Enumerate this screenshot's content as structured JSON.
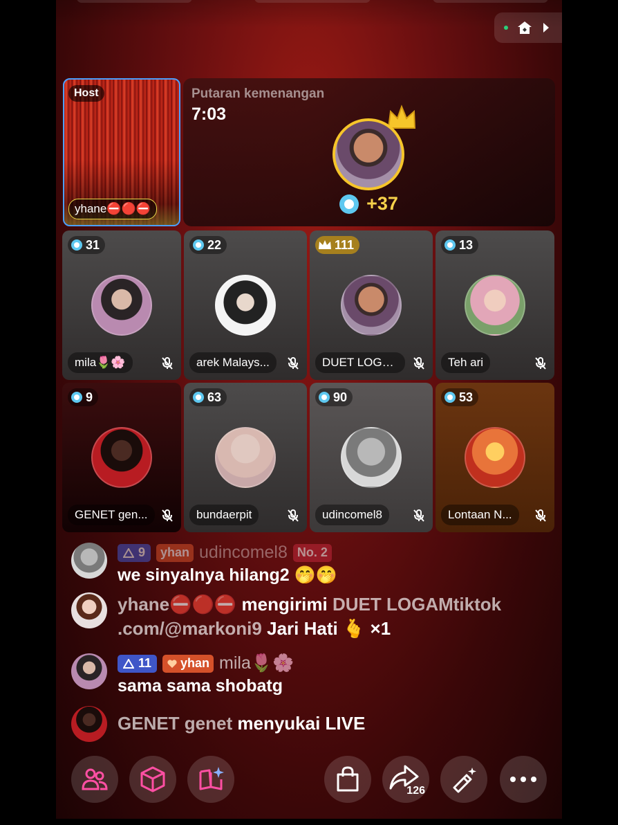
{
  "topbar": {
    "status_color": "#2bd07a"
  },
  "host_tile": {
    "badge": "Host",
    "name": "yhane⛔🔴⛔"
  },
  "round": {
    "label": "Putaran kemenangan",
    "timer": "7:03",
    "score": "+37"
  },
  "participants": [
    {
      "name": "mila🌷🌸",
      "points": "31",
      "badge": "diamond"
    },
    {
      "name": "arek Malays...",
      "points": "22",
      "badge": "diamond"
    },
    {
      "name": "DUET LOGA...",
      "points": "111",
      "badge": "crown"
    },
    {
      "name": "Teh ari",
      "points": "13",
      "badge": "diamond"
    },
    {
      "name": "GENET gen...",
      "points": "9",
      "badge": "diamond"
    },
    {
      "name": "bundaerpit",
      "points": "63",
      "badge": "diamond"
    },
    {
      "name": "udincomel8",
      "points": "90",
      "badge": "diamond"
    },
    {
      "name": "Lontaan N...",
      "points": "53",
      "badge": "diamond"
    }
  ],
  "chat": {
    "msg1": {
      "level": "9",
      "fan": "yhan",
      "user": "udincomel8",
      "rank": "No. 2",
      "text": "we sinyalnya hilang2 🤭🤭"
    },
    "msg2": {
      "user": "yhane⛔🔴⛔",
      "verb": "mengirimi",
      "target": "DUET LOGAMtiktok .com/@markoni9",
      "gift": "Jari Hati 🫰 ×1"
    },
    "msg3": {
      "level": "11",
      "fan": "yhan",
      "user": "mila🌷🌸",
      "text": "sama sama shobatg"
    },
    "msg4": {
      "user": "GENET genet",
      "text": "menyukai LIVE"
    }
  },
  "toolbar": {
    "share_count": "126"
  },
  "colors": {
    "accent_pink": "#ff4fa3",
    "gold": "#f7d14a",
    "diamond": "#5ec8f0"
  }
}
